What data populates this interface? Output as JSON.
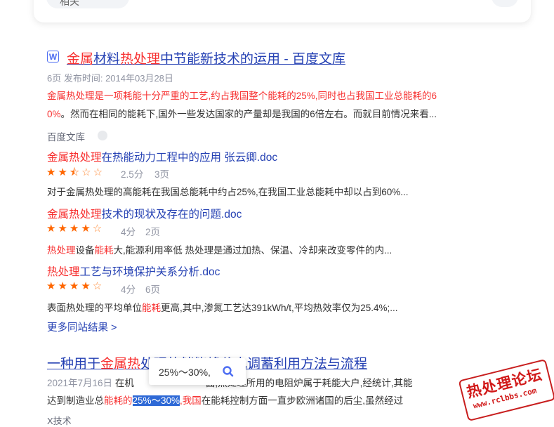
{
  "top": {
    "chip_label": "相关"
  },
  "result1": {
    "icon": "W",
    "title_parts": [
      "金属",
      "材料",
      "热处理",
      "中节能新技术的运用 - 百度文库"
    ],
    "meta": "6页 发布时间: 2014年03月28日",
    "snippet_line1": "金属热处理是一项耗能十分严重的工艺,约占我国整个能耗的25%,同时也占我国工业总能耗的6",
    "snippet_line2_red": "0%",
    "snippet_line2_rest": "。然而在相同的能耗下,国外一些发达国家的产量却是我国的6倍左右。而就目前情况来看...",
    "source": "百度文库",
    "docs": [
      {
        "title_hl": "金属热处理",
        "title_rest": "在热能动力工程中的应用 张云卿.doc",
        "rating": "2.5分",
        "pages": "3页",
        "snippet": "对于金属热处理的高能耗在我国总能耗中约占25%,在我国工业总能耗中却以占到60%..."
      },
      {
        "title_hl": "金属热处理",
        "title_rest": "技术的现状及存在的问题.doc",
        "rating": "4分",
        "pages": "2页",
        "snippet_hl1": "热处理",
        "snippet_mid": "设备",
        "snippet_hl2": "能耗",
        "snippet_rest": "大,能源利用率低 热处理是通过加热、保温、冷却来改变零件的内..."
      },
      {
        "title_hl": "热处理",
        "title_rest": "工艺与环境保护关系分析.doc",
        "rating": "4分",
        "pages": "6页",
        "snippet_a": "表面热处理的平均单位",
        "snippet_hl": "能耗",
        "snippet_b": "更高,其中,渗氮工艺达391kWh/t,平均热效率仅为25.4%;..."
      }
    ],
    "more": "更多同站结果 >"
  },
  "result2": {
    "title_a": "一种用于",
    "title_hl1": "金属热",
    "title_b": "处理的储能峰谷电调蓄利用方法与流程",
    "meta_date": "2021年7月16日",
    "meta_snip_a": "在机",
    "meta_snip_b": "面,热处理所用的电阻炉属于耗能大户,经统计,其能",
    "line2_a": "达到制造业总",
    "line2_hl1": "能耗的",
    "line2_sel": "25%～30%",
    "line2_hl2": ",我国",
    "line2_b": "在能耗控制方面一直步欧洲诸国的后尘,虽然经过",
    "source": "X技术"
  },
  "popup": {
    "text": "25%～30%,"
  },
  "watermark": {
    "line1": "热处理论坛",
    "line2": "www.rclbbs.com"
  },
  "colors": {
    "link": "#2440b3",
    "highlight": "#f73131",
    "star": "#ff6600",
    "selection": "#2e69d6"
  }
}
